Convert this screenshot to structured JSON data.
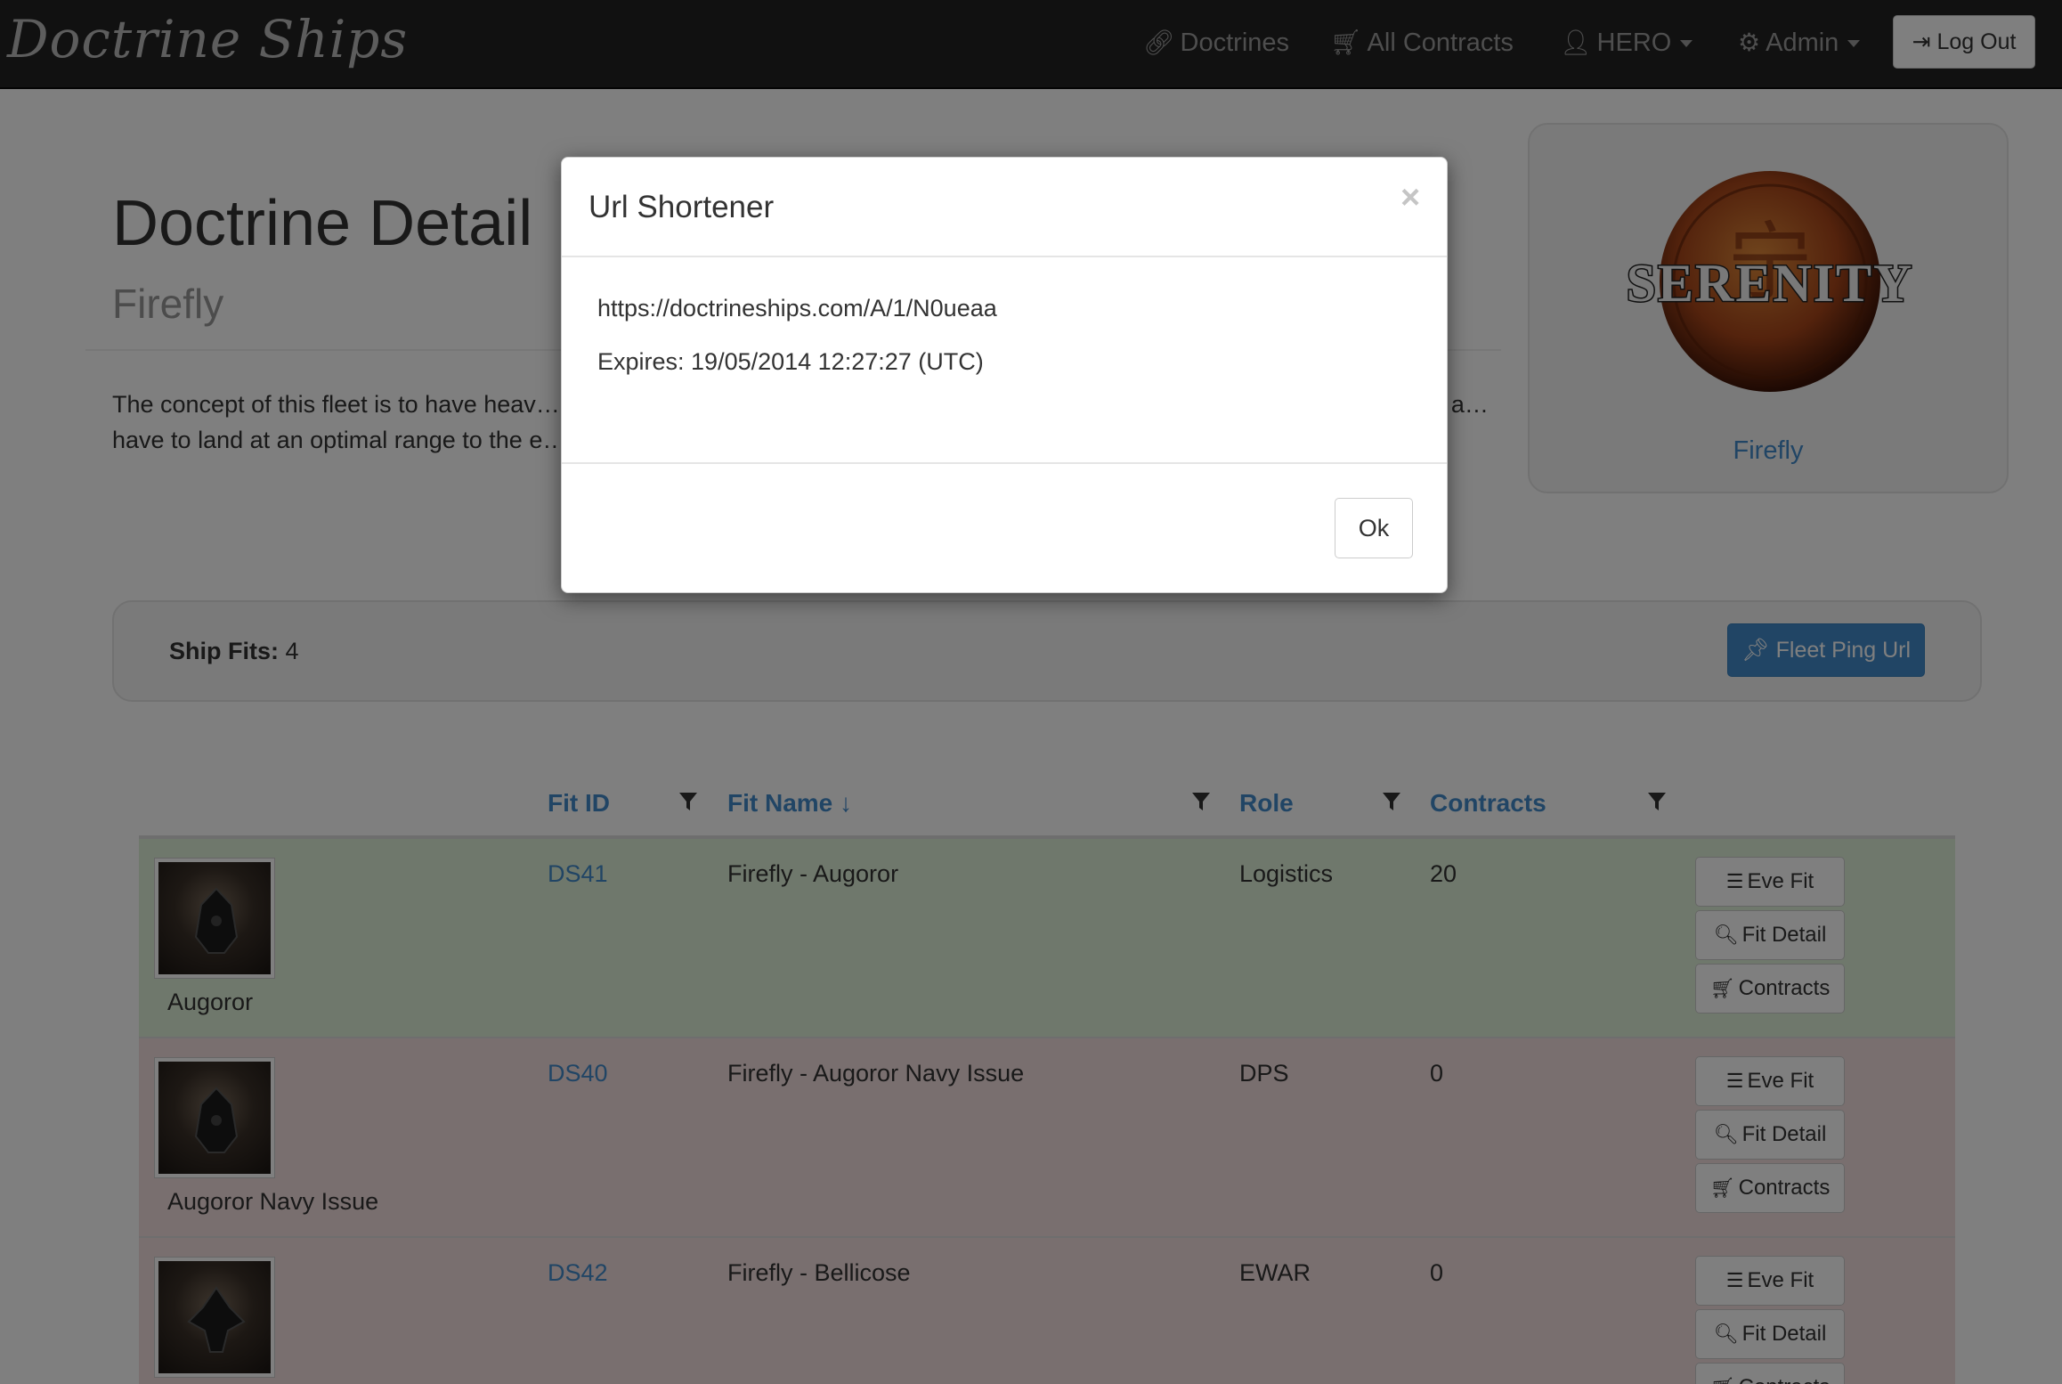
{
  "navbar": {
    "brand": "Doctrine Ships",
    "doctrines_label": "Doctrines",
    "all_contracts_label": "All Contracts",
    "user_label": "HERO",
    "admin_label": "Admin",
    "logout_label": "Log Out"
  },
  "page": {
    "title": "Doctrine Detail",
    "subtitle": "Firefly",
    "description": "The concept of this fleet is to have heav… radius while still retaining a higher speed… armor tank mods have speed penalties a… have to land at an optimal range to the e…",
    "card_label": "Firefly",
    "logo_text": "SERENITY"
  },
  "well": {
    "fits_label": "Ship Fits:",
    "fits_count": "4",
    "fleet_ping_label": "Fleet Ping Url"
  },
  "table": {
    "headers": {
      "fit_id": "Fit ID",
      "fit_name": "Fit Name ↓",
      "role": "Role",
      "contracts": "Contracts"
    },
    "rows": [
      {
        "ship": "Augoror",
        "fit_id": "DS41",
        "fit_name": "Firefly - Augoror",
        "role": "Logistics",
        "contracts": "20",
        "status": "success"
      },
      {
        "ship": "Augoror Navy Issue",
        "fit_id": "DS40",
        "fit_name": "Firefly - Augoror Navy Issue",
        "role": "DPS",
        "contracts": "0",
        "status": "danger"
      },
      {
        "ship": "",
        "fit_id": "DS42",
        "fit_name": "Firefly - Bellicose",
        "role": "EWAR",
        "contracts": "0",
        "status": "danger"
      }
    ],
    "buttons": {
      "eve_fit": "Eve Fit",
      "fit_detail": "Fit Detail",
      "contracts": "Contracts"
    }
  },
  "modal": {
    "title": "Url Shortener",
    "close": "×",
    "url": "https://doctrineships.com/A/1/N0ueaa",
    "expires": "Expires: 19/05/2014 12:27:27 (UTC)",
    "ok_label": "Ok"
  },
  "colors": {
    "navbar_bg": "#222222",
    "link": "#428bca",
    "success_row": "#dff0d8",
    "danger_row": "#f2dede",
    "primary_button": "#428bca"
  },
  "icons": [
    "link-icon",
    "cart-icon",
    "user-icon",
    "gear-icon",
    "logout-icon",
    "pushpin-icon",
    "filter-icon",
    "list-icon",
    "search-icon"
  ]
}
